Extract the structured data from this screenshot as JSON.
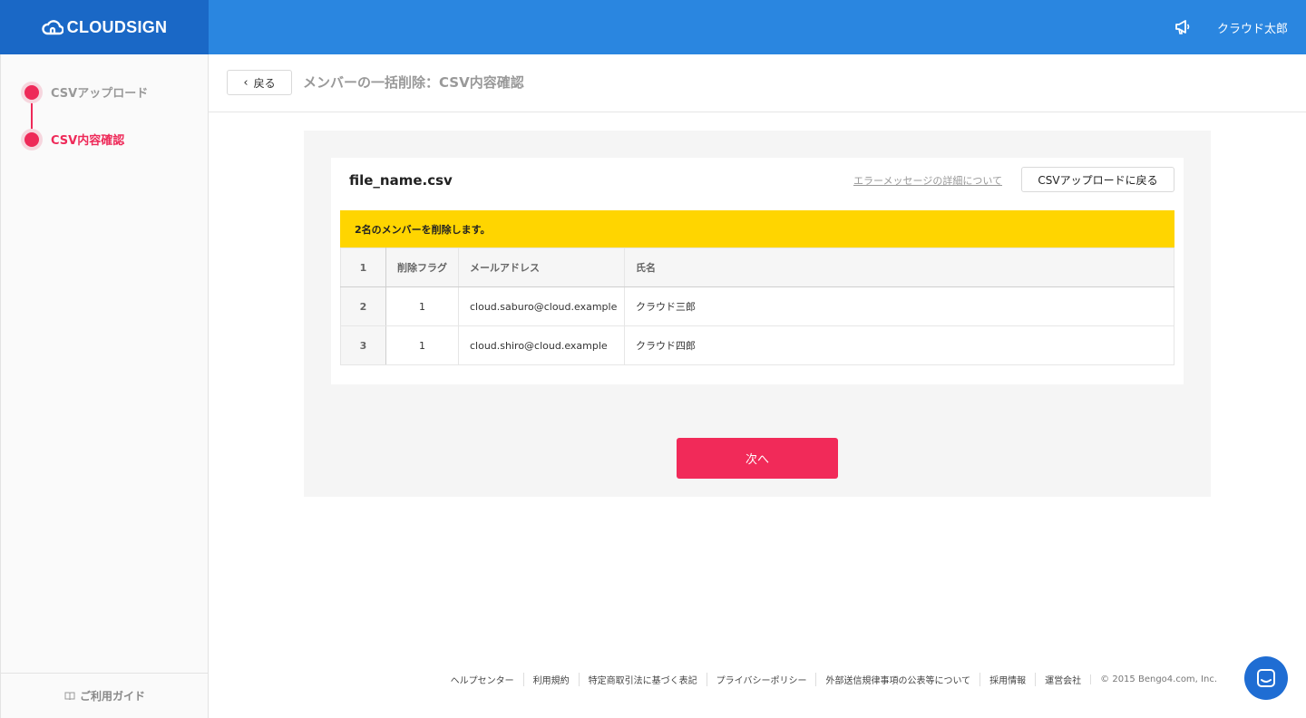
{
  "header": {
    "logo_text": "CLOUDSIGN",
    "user_name": "クラウド太郎"
  },
  "sidebar": {
    "steps": [
      {
        "label": "CSVアップロード",
        "state": "done"
      },
      {
        "label": "CSV内容確認",
        "state": "current"
      }
    ],
    "guide_label": "ご利用ガイド"
  },
  "page": {
    "back_label": "戻る",
    "title": "メンバーの一括削除：CSV内容確認"
  },
  "card": {
    "file_name": "file_name.csv",
    "error_link": "エラーメッセージの詳細について",
    "csv_back_label": "CSVアップロードに戻る",
    "notice": "2名のメンバーを削除します。"
  },
  "table": {
    "header": {
      "row_num": "1",
      "flag": "削除フラグ",
      "email": "メールアドレス",
      "name": "氏名"
    },
    "rows": [
      {
        "row_num": "2",
        "flag": "1",
        "email": "cloud.saburo@cloud.example",
        "name": "クラウド三郎"
      },
      {
        "row_num": "3",
        "flag": "1",
        "email": "cloud.shiro@cloud.example",
        "name": "クラウド四郎"
      }
    ]
  },
  "next_label": "次へ",
  "footer": {
    "links": [
      "ヘルプセンター",
      "利用規約",
      "特定商取引法に基づく表記",
      "プライバシーポリシー",
      "外部送信規律事項の公表等について",
      "採用情報",
      "運営会社"
    ],
    "copyright": "© 2015 Bengo4.com, Inc."
  },
  "colors": {
    "header_blue": "#2a86e0",
    "logo_blue": "#1a68c6",
    "accent_pink": "#f12a59",
    "notice_yellow": "#ffd500",
    "chat_blue": "#1f6dd3"
  }
}
